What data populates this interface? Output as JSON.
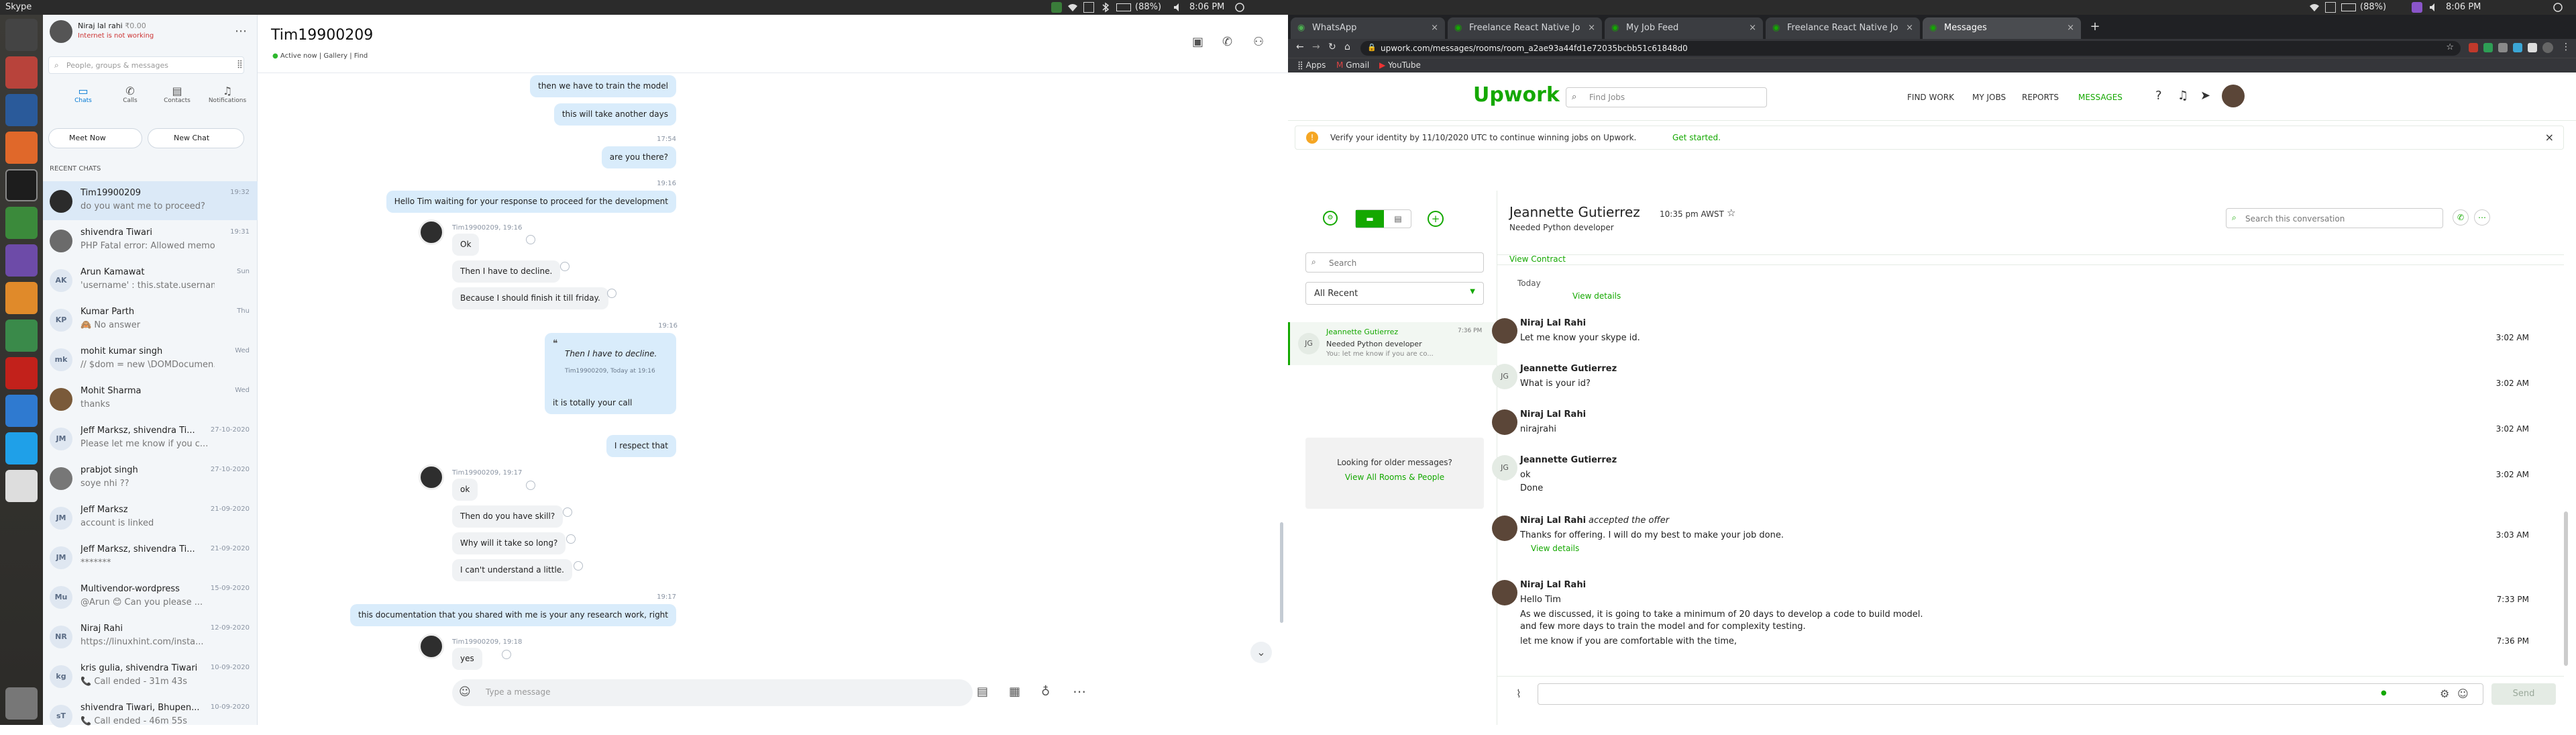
{
  "topbar": {
    "app_name": "Skype",
    "clock": "8:06 PM",
    "battery": "(88%)",
    "clock2": "8:06 PM",
    "battery2": "(88%)"
  },
  "skype": {
    "profile": {
      "name": "Niraj lal rahi",
      "balance": "₹0.00",
      "status": "Internet is not working"
    },
    "search_placeholder": "People, groups & messages",
    "nav": [
      {
        "label": "Chats"
      },
      {
        "label": "Calls"
      },
      {
        "label": "Contacts"
      },
      {
        "label": "Notifications"
      }
    ],
    "meet_now": "Meet Now",
    "new_chat": "New Chat",
    "recent_label": "RECENT CHATS",
    "chats": [
      {
        "initials": "",
        "name": "Tim19900209",
        "preview": "do you want me to proceed?",
        "time": "19:32"
      },
      {
        "initials": "",
        "name": "shivendra Tiwari",
        "preview": "PHP Fatal error:  Allowed memo...",
        "time": "19:31"
      },
      {
        "initials": "AK",
        "name": "Arun Kamawat",
        "preview": "'username' : this.state.username,",
        "time": "Sun"
      },
      {
        "initials": "KP",
        "name": "Kumar Parth",
        "preview": "🙈 No answer",
        "time": "Thu"
      },
      {
        "initials": "mk",
        "name": "mohit kumar singh",
        "preview": "// $dom = new \\DOMDocumen...",
        "time": "Wed"
      },
      {
        "initials": "",
        "name": "Mohit Sharma",
        "preview": "thanks",
        "time": "Wed"
      },
      {
        "initials": "JM",
        "name": "Jeff Marksz, shivendra Ti...",
        "preview": "Please let me know if you c...",
        "time": "27-10-2020"
      },
      {
        "initials": "",
        "name": "prabjot singh",
        "preview": "soye nhi ??",
        "time": "27-10-2020"
      },
      {
        "initials": "JM",
        "name": "Jeff Marksz",
        "preview": "account is linked",
        "time": "21-09-2020"
      },
      {
        "initials": "JM",
        "name": "Jeff Marksz, shivendra Ti...",
        "preview": "*******",
        "time": "21-09-2020"
      },
      {
        "initials": "Mu",
        "name": "Multivendor-wordpress",
        "preview": "@Arun 😊 Can you please ...",
        "time": "15-09-2020"
      },
      {
        "initials": "NR",
        "name": "Niraj Rahi",
        "preview": "https://linuxhint.com/insta...",
        "time": "12-09-2020"
      },
      {
        "initials": "kg",
        "name": "kris gulia, shivendra Tiwari",
        "preview": "📞 Call ended - 31m 43s",
        "time": "10-09-2020"
      },
      {
        "initials": "sT",
        "name": "shivendra Tiwari, Bhupen...",
        "preview": "📞 Call ended - 46m 55s",
        "time": "10-09-2020"
      }
    ],
    "conv": {
      "title": "Tim19900209",
      "status": "Active now",
      "gallery": "Gallery",
      "find": "Find",
      "messages": [
        {
          "dir": "out",
          "text": "then we have to train the model"
        },
        {
          "dir": "out",
          "text": "this will take another days"
        },
        {
          "dir": "meta",
          "text": "17:54"
        },
        {
          "dir": "out",
          "text": "are you there?"
        },
        {
          "dir": "meta",
          "text": "19:16"
        },
        {
          "dir": "out",
          "text": "Hello Tim waiting for your response to proceed for the development"
        },
        {
          "dir": "meta",
          "text": "Tim19900209, 19:16"
        },
        {
          "dir": "in",
          "text": "Ok"
        },
        {
          "dir": "in",
          "text": "Then I have to decline."
        },
        {
          "dir": "in",
          "text": "Because I should finish it till friday."
        },
        {
          "dir": "meta",
          "text": "19:16"
        },
        {
          "dir": "out",
          "text": "Then I have to decline."
        },
        {
          "dir": "meta",
          "text": "Tim19900209, Today at 19:16"
        },
        {
          "dir": "out",
          "text": "it is totally your call"
        },
        {
          "dir": "out",
          "text": "I respect that"
        },
        {
          "dir": "meta",
          "text": "Tim19900209, 19:17"
        },
        {
          "dir": "in",
          "text": "ok"
        },
        {
          "dir": "in",
          "text": "Then do you have skill?"
        },
        {
          "dir": "in",
          "text": "Why will it take so long?"
        },
        {
          "dir": "in",
          "text": "I can't understand a little."
        },
        {
          "dir": "meta",
          "text": "19:17"
        },
        {
          "dir": "out",
          "text": "this documentation that you shared with me is your any research work, right"
        },
        {
          "dir": "meta",
          "text": "Tim19900209, 19:18"
        },
        {
          "dir": "in",
          "text": "yes"
        }
      ],
      "input_placeholder": "Type a message"
    }
  },
  "chrome": {
    "tabs": [
      {
        "title": "WhatsApp"
      },
      {
        "title": "Freelance React Native Jo"
      },
      {
        "title": "My Job Feed"
      },
      {
        "title": "Freelance React Native Jo"
      },
      {
        "title": "Messages"
      }
    ],
    "url": "upwork.com/messages/rooms/room_a2ae93a44fd1e72035bcbb51c61848d0",
    "bookmarks": [
      "Apps",
      "Gmail",
      "YouTube"
    ]
  },
  "upwork": {
    "logo": "Upwork",
    "search_placeholder": "Find Jobs",
    "nav": [
      "FIND WORK",
      "MY JOBS",
      "REPORTS",
      "MESSAGES"
    ],
    "banner": {
      "text": "Verify your identity by 11/10/2020 UTC to continue winning jobs on Upwork.",
      "link": "Get started."
    },
    "rooms_search": "Search",
    "filter": "All Recent",
    "room": {
      "initials": "JG",
      "name": "Jeannette Gutierrez",
      "time": "7:36 PM",
      "subtitle": "Needed Python developer",
      "preview": "You: let me know if you are co..."
    },
    "older": {
      "text": "Looking for older messages?",
      "link": "View All Rooms & People"
    },
    "header": {
      "name": "Jeannette Gutierrez",
      "time": "10:35 pm AWST",
      "subtitle": "Needed Python developer",
      "search_placeholder": "Search this conversation",
      "view_contract": "View Contract"
    },
    "today": "Today",
    "view_details_top": "View details",
    "messages": [
      {
        "av": "img",
        "name": "Niraj Lal Rahi",
        "text": "Let me know your skype id.",
        "time": "3:02 AM"
      },
      {
        "av": "JG",
        "name": "Jeannette Gutierrez",
        "text": "What is your id?",
        "time": "3:02 AM"
      },
      {
        "av": "img",
        "name": "Niraj Lal Rahi",
        "text": "nirajrahi",
        "time": "3:02 AM"
      },
      {
        "av": "JG",
        "name": "Jeannette Gutierrez",
        "text": "ok",
        "time": "3:02 AM",
        "text2": "Done"
      },
      {
        "av": "img",
        "name": "Niraj Lal Rahi",
        "action": "accepted the offer",
        "text": "Thanks for offering. I will do my best to make your job done.",
        "time": "3:03 AM",
        "link": "View details"
      },
      {
        "av": "img",
        "name": "Niraj Lal Rahi",
        "text": "Hello Tim",
        "time": "7:33 PM",
        "lines": [
          "As we discussed, it is going to take a minimum of 20 days to develop a code to build model.",
          "and few more days to train the model and for complexity testing.",
          "let me know if you are comfortable with the time,"
        ],
        "time2": "7:36 PM"
      }
    ],
    "send": "Send"
  }
}
